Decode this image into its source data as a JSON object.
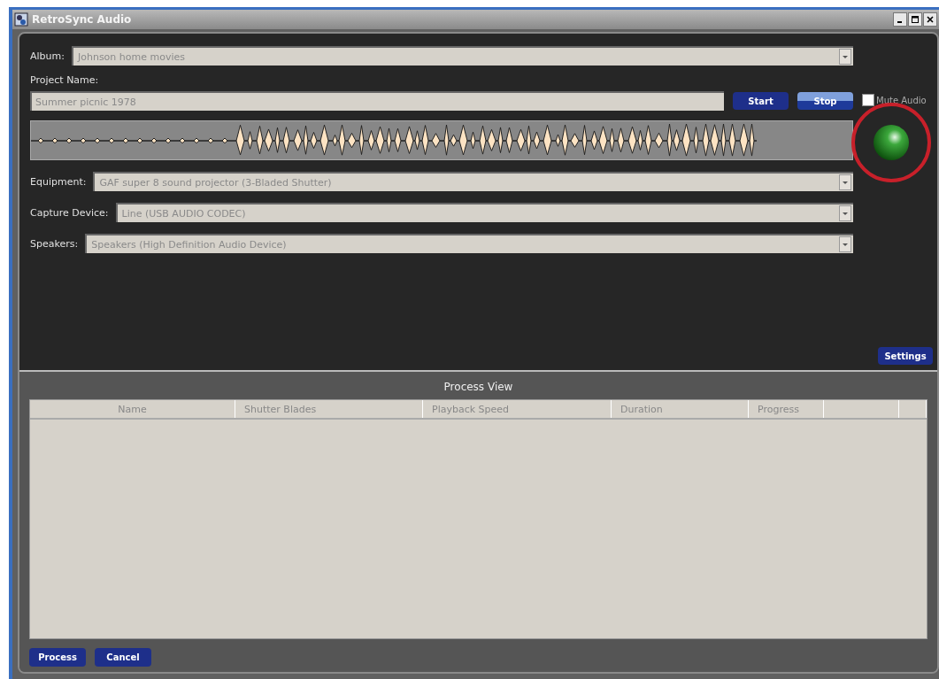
{
  "window": {
    "title": "RetroSync Audio"
  },
  "album": {
    "label": "Album:",
    "value": "Johnson home movies"
  },
  "project": {
    "label": "Project Name:",
    "value": "Summer picnic 1978"
  },
  "transport": [
    {
      "label": "Start",
      "highlighted": false
    },
    {
      "label": "Stop",
      "highlighted": true
    }
  ],
  "mute": {
    "label": "Mute Audio",
    "checked": false
  },
  "signal_light": {
    "on": true
  },
  "devices": [
    {
      "label": "Equipment:",
      "value": "GAF super 8 sound projector (3-Bladed Shutter)"
    },
    {
      "label": "Capture Device:",
      "value": "Line (USB AUDIO  CODEC)"
    },
    {
      "label": "Speakers:",
      "value": "Speakers (High Definition Audio Device)"
    }
  ],
  "settings_button": "Settings",
  "process_view": {
    "title": "Process View",
    "columns": [
      "Name",
      "Shutter Blades",
      "Playback Speed",
      "Duration",
      "Progress"
    ]
  },
  "footer_buttons": [
    "Process",
    "Cancel"
  ]
}
